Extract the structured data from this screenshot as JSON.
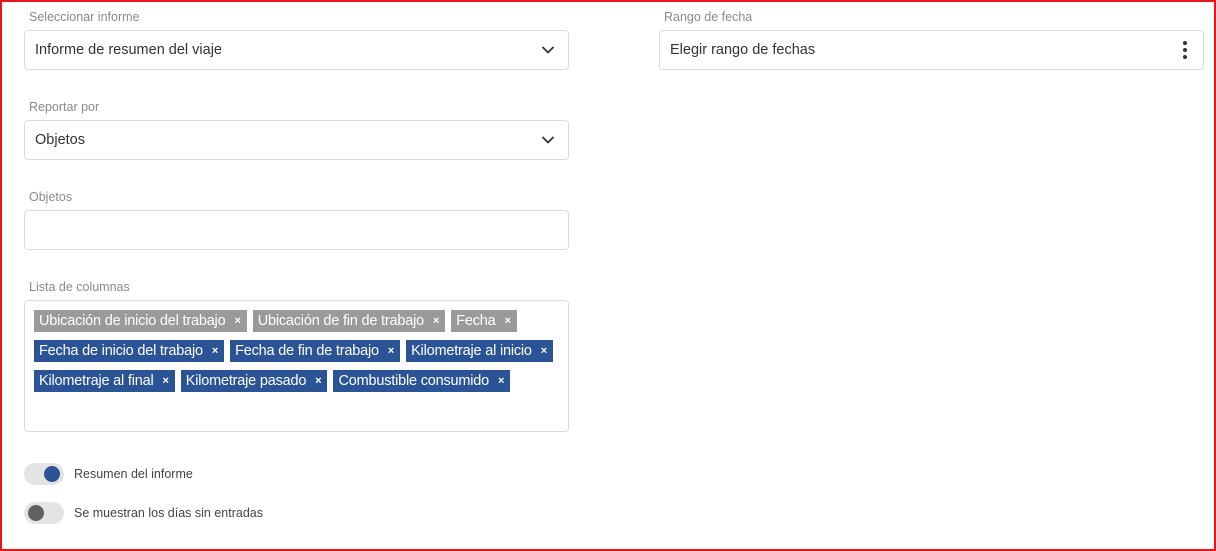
{
  "report_select": {
    "label": "Seleccionar informe",
    "value": "Informe de resumen del viaje"
  },
  "date_range": {
    "label": "Rango de fecha",
    "value": "Elegir rango de fechas"
  },
  "report_by": {
    "label": "Reportar por",
    "value": "Objetos"
  },
  "objects": {
    "label": "Objetos",
    "value": ""
  },
  "columns": {
    "label": "Lista de columnas",
    "tags": [
      {
        "text": "Ubicación de inicio del trabajo",
        "state": "gray"
      },
      {
        "text": "Ubicación de fin de trabajo",
        "state": "gray"
      },
      {
        "text": "Fecha",
        "state": "gray"
      },
      {
        "text": "Fecha de inicio del trabajo",
        "state": "blue"
      },
      {
        "text": "Fecha de fin de trabajo",
        "state": "blue"
      },
      {
        "text": "Kilometraje al inicio",
        "state": "blue"
      },
      {
        "text": "Kilometraje al final",
        "state": "blue"
      },
      {
        "text": "Kilometraje pasado",
        "state": "blue"
      },
      {
        "text": "Combustible consumido",
        "state": "blue"
      }
    ],
    "remove_glyph": "×"
  },
  "toggles": {
    "summary": {
      "label": "Resumen del informe",
      "on": true
    },
    "empty_days": {
      "label": "Se muestran los días sin entradas",
      "on": false
    }
  },
  "colors": {
    "accent": "#2b5496",
    "tag_gray": "#9a9a9a",
    "frame": "#e8161c"
  },
  "icons": {
    "select_chevron": "chevron-down-icon",
    "date_menu": "kebab-menu-icon"
  }
}
